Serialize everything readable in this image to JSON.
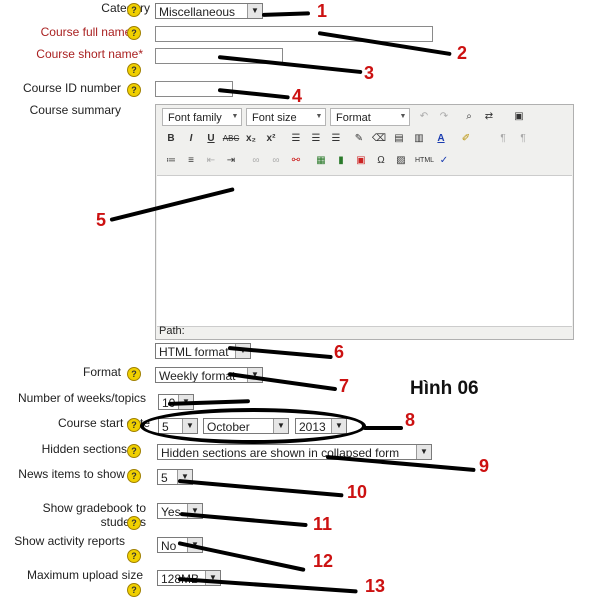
{
  "form": {
    "category": {
      "label": "Category",
      "value": "Miscellaneous"
    },
    "fullname": {
      "label": "Course full name",
      "required": "*"
    },
    "shortname": {
      "label": "Course short name",
      "required": "*"
    },
    "idnumber": {
      "label": "Course ID number"
    },
    "summary": {
      "label": "Course summary"
    },
    "format_select": {
      "value": "HTML format"
    },
    "format": {
      "label": "Format",
      "value": "Weekly format"
    },
    "numweeks": {
      "label": "Number of weeks/topics",
      "value": "10"
    },
    "startdate": {
      "label": "Course start date",
      "day": "5",
      "month": "October",
      "year": "2013"
    },
    "hidden": {
      "label": "Hidden sections",
      "value": "Hidden sections are shown in collapsed form"
    },
    "news": {
      "label": "News items to show",
      "value": "5"
    },
    "gradebook": {
      "label": "Show gradebook to students",
      "value": "Yes"
    },
    "activity": {
      "label": "Show activity reports",
      "value": "No"
    },
    "maxupload": {
      "label": "Maximum upload size",
      "value": "128MB"
    }
  },
  "editor": {
    "font_family": "Font family",
    "font_size": "Font size",
    "format": "Format",
    "path_label": "Path:",
    "buttons_row2": [
      "B",
      "I",
      "U",
      "ABC",
      "x₂",
      "x²"
    ]
  },
  "annotations": {
    "numbers": [
      "1",
      "2",
      "3",
      "4",
      "5",
      "6",
      "7",
      "8",
      "9",
      "10",
      "11",
      "12",
      "13"
    ],
    "figure_label": "Hình 06"
  },
  "colors": {
    "required": "#aa2222",
    "annotation": "#cc1111",
    "help_icon": "#f0d000"
  }
}
